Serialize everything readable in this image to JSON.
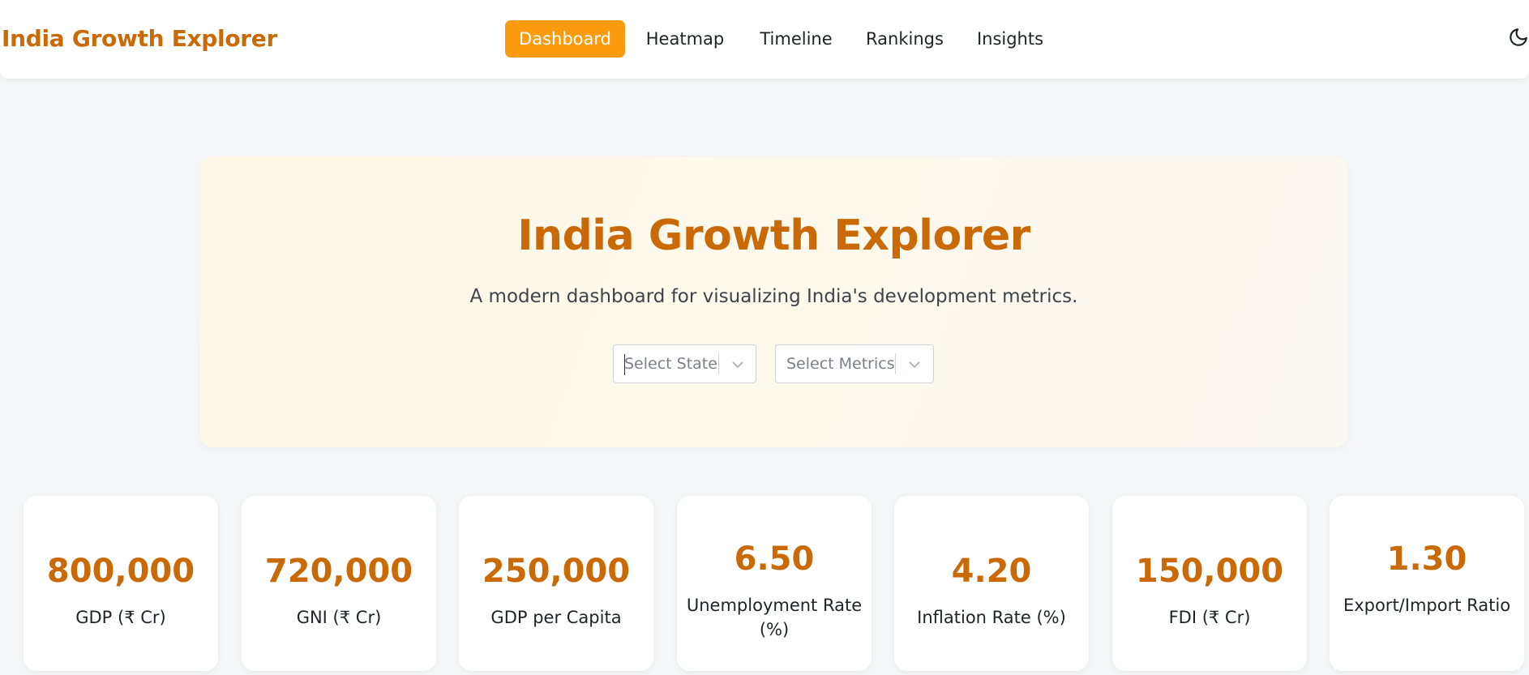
{
  "navbar": {
    "brand": "India Growth Explorer",
    "links": [
      {
        "label": "Dashboard",
        "active": true
      },
      {
        "label": "Heatmap",
        "active": false
      },
      {
        "label": "Timeline",
        "active": false
      },
      {
        "label": "Rankings",
        "active": false
      },
      {
        "label": "Insights",
        "active": false
      }
    ],
    "theme_toggle_icon": "moon-icon"
  },
  "hero": {
    "title": "India Growth Explorer",
    "subtitle": "A modern dashboard for visualizing India's development metrics.",
    "state_select": {
      "placeholder": "Select State",
      "icon": "chevron-down-icon"
    },
    "metrics_select": {
      "placeholder": "Select Metrics",
      "icon": "chevron-down-icon"
    }
  },
  "metrics": [
    {
      "value": "800,000",
      "label": "GDP (₹ Cr)"
    },
    {
      "value": "720,000",
      "label": "GNI (₹ Cr)"
    },
    {
      "value": "250,000",
      "label": "GDP per Capita"
    },
    {
      "value": "6.50",
      "label": "Unemployment Rate (%)"
    },
    {
      "value": "4.20",
      "label": "Inflation Rate (%)"
    },
    {
      "value": "150,000",
      "label": "FDI (₹ Cr)"
    },
    {
      "value": "1.30",
      "label": "Export/Import Ratio"
    }
  ],
  "colors": {
    "accent": "#c96a06",
    "active_tab": "#fb9c0f",
    "background": "#f5f6f8",
    "hero_bg": "#fdf8e6"
  }
}
